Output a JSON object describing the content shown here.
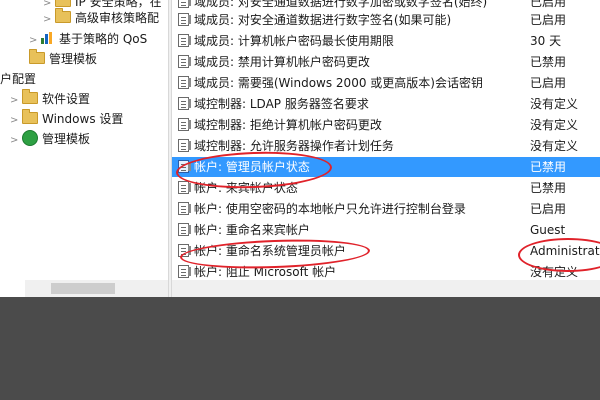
{
  "tree": {
    "items": [
      {
        "label": "IP 安全策略，在",
        "icon": "folder-icon"
      },
      {
        "label": "高级审核策略配",
        "icon": "folder-icon"
      },
      {
        "label": "基于策略的 QoS",
        "icon": "chart-icon"
      },
      {
        "label": "管理模板",
        "icon": "folder-icon"
      },
      {
        "label": "户配置",
        "icon": ""
      },
      {
        "label": "软件设置",
        "icon": "folder-icon"
      },
      {
        "label": "Windows 设置",
        "icon": "folder-icon"
      },
      {
        "label": "管理模板",
        "icon": "green-icon"
      }
    ]
  },
  "policies": [
    {
      "name": "域成员: 对安全通道数据进行数字加密或数字签名(始终)",
      "setting": "已启用"
    },
    {
      "name": "域成员: 对安全通道数据进行数字签名(如果可能)",
      "setting": "已启用"
    },
    {
      "name": "域成员: 计算机帐户密码最长使用期限",
      "setting": "30 天"
    },
    {
      "name": "域成员: 禁用计算机帐户密码更改",
      "setting": "已禁用"
    },
    {
      "name": "域成员: 需要强(Windows 2000 或更高版本)会话密钥",
      "setting": "已启用"
    },
    {
      "name": "域控制器: LDAP 服务器签名要求",
      "setting": "没有定义"
    },
    {
      "name": "域控制器: 拒绝计算机帐户密码更改",
      "setting": "没有定义"
    },
    {
      "name": "域控制器: 允许服务器操作者计划任务",
      "setting": "没有定义"
    },
    {
      "name": "帐户: 管理员帐户状态",
      "setting": "已禁用"
    },
    {
      "name": "帐户: 来宾帐户状态",
      "setting": "已禁用"
    },
    {
      "name": "帐户: 使用空密码的本地帐户只允许进行控制台登录",
      "setting": "已启用"
    },
    {
      "name": "帐户: 重命名来宾帐户",
      "setting": "Guest"
    },
    {
      "name": "帐户: 重命名系统管理员帐户",
      "setting": "Administrator"
    },
    {
      "name": "帐户: 阻止 Microsoft 帐户",
      "setting": "没有定义"
    }
  ],
  "colors": {
    "selection": "#3399ff",
    "annotation": "#e0222a"
  }
}
